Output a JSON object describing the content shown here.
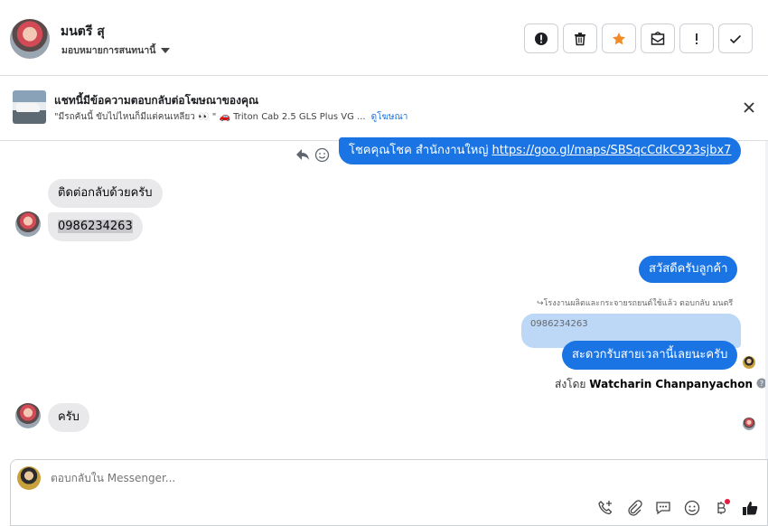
{
  "header": {
    "contact_name": "มนตรี สุ",
    "assign_label": "มอบหมายการสนทนานี้"
  },
  "ad": {
    "title": "แชทนี้มีข้อความตอบกลับต่อโฆษณาของคุณ",
    "snippet": "\"มีรถคันนี้ ขับไปไหนก็มีแต่คนเหลียว 👀 \" 🚗 Triton Cab 2.5 GLS Plus VG ...",
    "link_label": "ดูโฆษณา"
  },
  "messages": {
    "m1_prefix": "โชคคุณโชค สำนักงานใหญ่ ",
    "m1_link": "https://goo.gl/maps/SBSqcCdkC923sjbx7",
    "m2": "ติดต่อกลับด้วยครับ",
    "m3": "0986234263",
    "m4": "สวัสดีครับลูกค้า",
    "reply_meta": "โรงงานผลิตและกระจายรถยนต์ใช้แล้ว ตอบกลับ มนตรี",
    "quoted": "0986234263",
    "m5": "สะดวกรับสายเวลานี้เลยนะครับ",
    "sent_by_prefix": "ส่งโดย ",
    "sent_by_name": "Watcharin Chanpanyachon",
    "m6": "ครับ"
  },
  "composer": {
    "placeholder": "ตอบกลับใน Messenger..."
  },
  "colors": {
    "outgoing": "#1b74e4",
    "incoming": "#e9e9eb",
    "star": "#f28c28"
  }
}
